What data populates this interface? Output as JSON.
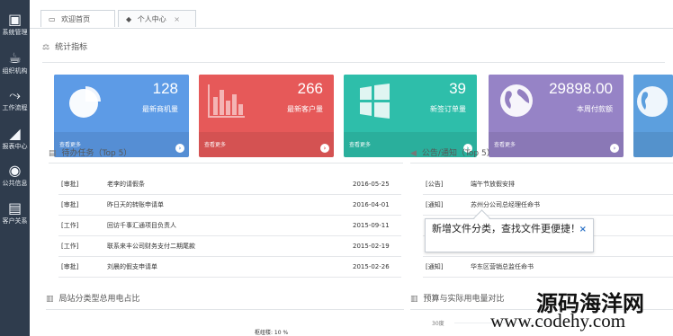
{
  "sidebar": {
    "items": [
      {
        "label": "系统管理",
        "icon": "monitor-icon",
        "glyph": "▣"
      },
      {
        "label": "组织机构",
        "icon": "cup-icon",
        "glyph": "☕"
      },
      {
        "label": "工作流程",
        "icon": "share-icon",
        "glyph": "⤳"
      },
      {
        "label": "报表中心",
        "icon": "chart-icon",
        "glyph": "◢"
      },
      {
        "label": "公共信息",
        "icon": "globe-icon",
        "glyph": "◉"
      },
      {
        "label": "客户关系",
        "icon": "briefcase-icon",
        "glyph": "▤"
      }
    ]
  },
  "tabs": [
    {
      "label": "欢迎首页",
      "icon": "monitor-icon",
      "glyph": "▭",
      "active": true
    },
    {
      "label": "个人中心",
      "icon": "user-icon",
      "glyph": "◆",
      "active": false,
      "close": "×"
    }
  ],
  "stats": {
    "title": "统计指标",
    "icon": "scale-icon",
    "cards": [
      {
        "value": "128",
        "label": "最新商机量",
        "link": "查看更多",
        "color": "#5d9be6",
        "icon": "pie-icon",
        "arrow": "›"
      },
      {
        "value": "266",
        "label": "最新客户量",
        "link": "查看更多",
        "color": "#e65959",
        "icon": "bar-icon",
        "arrow": "›"
      },
      {
        "value": "39",
        "label": "新签订单量",
        "link": "查看更多",
        "color": "#2ebeaa",
        "icon": "windows-icon",
        "arrow": "›"
      },
      {
        "value": "29898.00",
        "label": "本周付款额",
        "link": "查看更多",
        "color": "#9683c6",
        "icon": "globe-icon",
        "arrow": "›"
      },
      {
        "value": "",
        "label": "",
        "link": "",
        "color": "#5c9fde",
        "icon": "globe-icon",
        "arrow": ""
      }
    ]
  },
  "tasks": {
    "title": "待办任务（Top 5）",
    "icon": "list-icon",
    "rows": [
      {
        "tag": "[审批]",
        "text": "老李的请假条",
        "date": "2016-05-25"
      },
      {
        "tag": "[审批]",
        "text": "昨日天的转账申请单",
        "date": "2016-04-01"
      },
      {
        "tag": "[工作]",
        "text": "回访千事汇通项目负责人",
        "date": "2015-09-11"
      },
      {
        "tag": "[工作]",
        "text": "联系来丰公司财务支付二期尾款",
        "date": "2015-02-19"
      },
      {
        "tag": "[审批]",
        "text": "刘晨的假支申请单",
        "date": "2015-02-26"
      }
    ]
  },
  "notices": {
    "title": "公告/通知（Top 5）",
    "icon": "megaphone-icon",
    "rows": [
      {
        "tag": "[公告]",
        "text": "端午节放假安排"
      },
      {
        "tag": "[通知]",
        "text": "苏州分公司总经理任命书"
      },
      {
        "tag": "",
        "text": ""
      },
      {
        "tag": "",
        "text": ""
      },
      {
        "tag": "[通知]",
        "text": "华东区营销总监任命书"
      }
    ],
    "tooltip": "新增文件分类，查找文件更便捷！",
    "tooltip_close": "×"
  },
  "bottom": {
    "left_title": "局站分类型总用电占比",
    "right_title": "预算与实际用电量对比",
    "pie_label": "枢纽楼: 10 %",
    "axis_label": "30度"
  },
  "watermark": {
    "main": "源码海洋网",
    "url": "www.codehy.com"
  }
}
